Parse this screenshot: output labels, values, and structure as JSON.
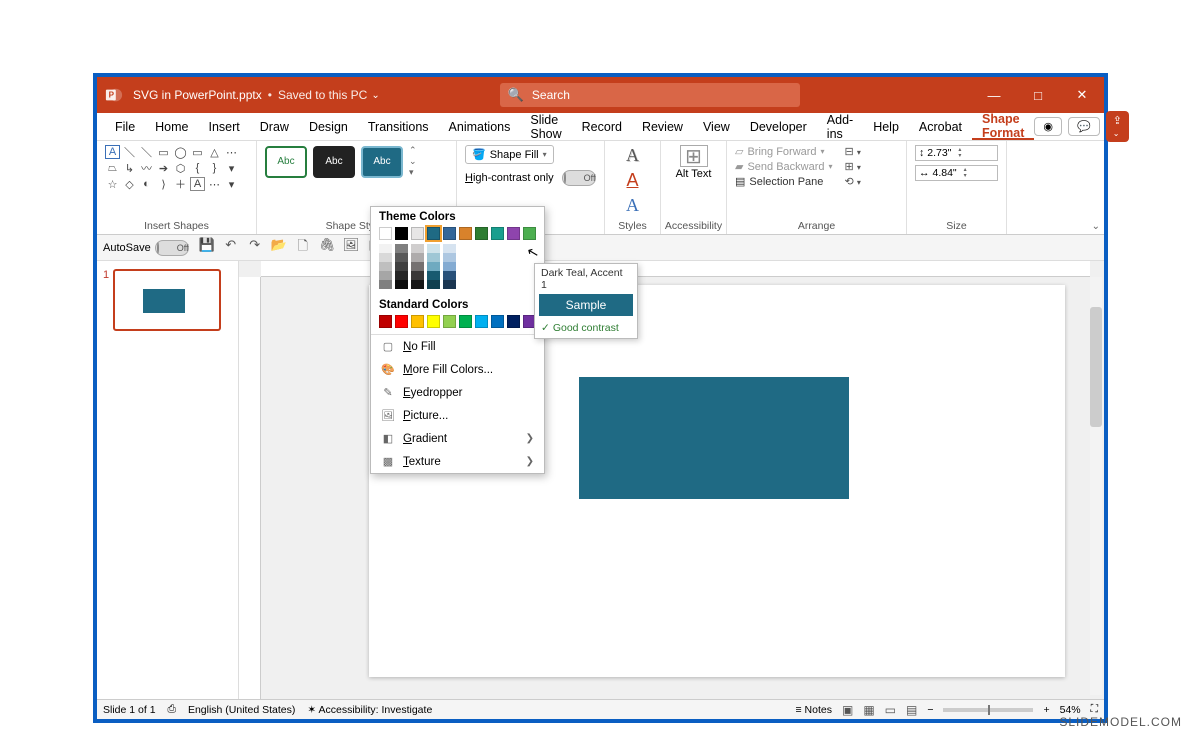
{
  "titlebar": {
    "filename": "SVG in PowerPoint.pptx",
    "saved_status": "Saved to this PC",
    "separator": "•"
  },
  "search": {
    "placeholder": "Search"
  },
  "window_controls": {
    "minimize": "—",
    "maximize": "□",
    "close": "✕"
  },
  "tabs": [
    "File",
    "Home",
    "Insert",
    "Draw",
    "Design",
    "Transitions",
    "Animations",
    "Slide Show",
    "Record",
    "Review",
    "View",
    "Developer",
    "Add-ins",
    "Help",
    "Acrobat",
    "Shape Format"
  ],
  "active_tab": "Shape Format",
  "ribbon": {
    "groups": {
      "insert_shapes": "Insert Shapes",
      "shape_styles": "Shape Styles",
      "wordart_styles": "Styles",
      "accessibility": "Accessibility",
      "arrange": "Arrange",
      "size": "Size"
    },
    "style_sample_label": "Abc",
    "shape_fill_label": "Shape Fill",
    "high_contrast_label": "High-contrast only",
    "high_contrast_state": "Off",
    "alt_text_label": "Alt Text",
    "arrange_items": {
      "bring_forward": "Bring Forward",
      "send_backward": "Send Backward",
      "selection_pane": "Selection Pane"
    },
    "size_height": "2.73\"",
    "size_width": "4.84\""
  },
  "qat": {
    "autosave_label": "AutoSave",
    "autosave_state": "Off"
  },
  "thumbnail": {
    "slide_number": "1"
  },
  "statusbar": {
    "slide_info": "Slide 1 of 1",
    "language": "English (United States)",
    "accessibility": "Accessibility: Investigate",
    "notes_label": "Notes",
    "zoom_percent": "54%"
  },
  "dropdown": {
    "theme_colors_label": "Theme Colors",
    "theme_colors_row": [
      "#ffffff",
      "#000000",
      "#e7e6e6",
      "#1f6a84",
      "#336699",
      "#d9822b",
      "#2e7d32",
      "#1a9e8e",
      "#8e44ad",
      "#4caf50"
    ],
    "shade_columns": [
      [
        "#f2f2f2",
        "#d9d9d9",
        "#bfbfbf",
        "#a6a6a6",
        "#808080"
      ],
      [
        "#7f7f7f",
        "#595959",
        "#404040",
        "#262626",
        "#0d0d0d"
      ],
      [
        "#d0cece",
        "#aeabab",
        "#757171",
        "#3a3838",
        "#161616"
      ],
      [
        "#cfe3ea",
        "#9fc7d5",
        "#6faac0",
        "#185a70",
        "#10404f"
      ],
      [
        "#d6e3f0",
        "#adc7e1",
        "#84abd2",
        "#28517a",
        "#1b3651"
      ]
    ],
    "standard_colors_label": "Standard Colors",
    "standard_colors": [
      "#c00000",
      "#ff0000",
      "#ffc000",
      "#ffff00",
      "#92d050",
      "#00b050",
      "#00b0f0",
      "#0070c0",
      "#002060",
      "#7030a0"
    ],
    "items": {
      "no_fill": "No Fill",
      "more_colors": "More Fill Colors...",
      "eyedropper": "Eyedropper",
      "picture": "Picture...",
      "gradient": "Gradient",
      "texture": "Texture"
    }
  },
  "tooltip": {
    "color_name": "Dark Teal, Accent 1",
    "sample_label": "Sample",
    "contrast_label": "Good contrast"
  },
  "watermark": "SLIDEMODEL.COM"
}
